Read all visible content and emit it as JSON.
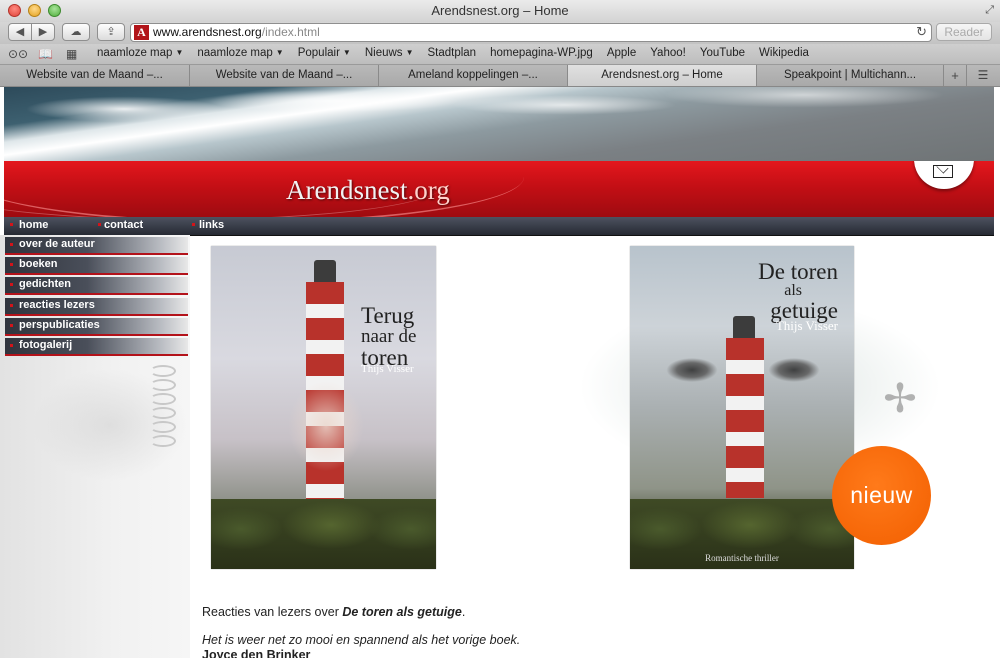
{
  "window": {
    "title": "Arendsnest.org – Home"
  },
  "toolbar": {
    "url_host": "www.arendsnest.org",
    "url_path": "/index.html",
    "reader_label": "Reader"
  },
  "bookmarks": [
    {
      "label": "naamloze map",
      "has_menu": true
    },
    {
      "label": "naamloze map",
      "has_menu": true
    },
    {
      "label": "Populair",
      "has_menu": true
    },
    {
      "label": "Nieuws",
      "has_menu": true
    },
    {
      "label": "Stadtplan",
      "has_menu": false
    },
    {
      "label": "homepagina-WP.jpg",
      "has_menu": false
    },
    {
      "label": "Apple",
      "has_menu": false
    },
    {
      "label": "Yahoo!",
      "has_menu": false
    },
    {
      "label": "YouTube",
      "has_menu": false
    },
    {
      "label": "Wikipedia",
      "has_menu": false
    }
  ],
  "tabs": [
    {
      "label": "Website van de Maand –...",
      "active": false
    },
    {
      "label": "Website van de Maand –...",
      "active": false
    },
    {
      "label": "Ameland koppelingen –...",
      "active": false
    },
    {
      "label": "Arendsnest.org – Home",
      "active": true
    },
    {
      "label": "Speakpoint | Multichann...",
      "active": false
    }
  ],
  "site": {
    "title_main": "Arendsnest",
    "title_tld": ".org"
  },
  "topnav": {
    "home": "home",
    "contact": "contact",
    "links": "links"
  },
  "sidebar": {
    "items": [
      {
        "label": "over de auteur"
      },
      {
        "label": "boeken"
      },
      {
        "label": "gedichten"
      },
      {
        "label": "reacties lezers"
      },
      {
        "label": "perspublicaties"
      },
      {
        "label": "fotogalerij"
      }
    ]
  },
  "books": {
    "book1": {
      "title_lines": [
        "Terug",
        "naar de",
        "toren"
      ],
      "author": "Thijs Visser"
    },
    "book2": {
      "title_lines": [
        "De toren",
        "als",
        "getuige"
      ],
      "author": "Thijs Visser",
      "genre": "Romantische thriller",
      "badge": "nieuw"
    }
  },
  "reviews": {
    "intro": "Reacties van lezers over ",
    "book_title": "De toren als getuige",
    "intro_end": ".",
    "quote": "Het is weer net zo mooi en spannend als het vorige boek.",
    "author": "Joyce den Brinker"
  },
  "colors": {
    "banner_red": "#c40f15",
    "nav_dark": "#262a33",
    "badge_orange": "#f25f00"
  }
}
